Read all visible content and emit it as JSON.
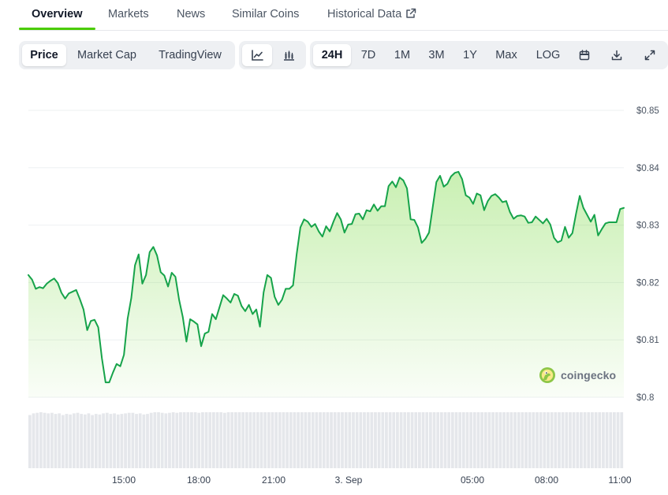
{
  "tabs": [
    {
      "label": "Overview",
      "active": true
    },
    {
      "label": "Markets"
    },
    {
      "label": "News"
    },
    {
      "label": "Similar Coins"
    },
    {
      "label": "Historical Data",
      "icon": "external-link-icon"
    }
  ],
  "toolbar": {
    "view_tabs": [
      "Price",
      "Market Cap",
      "TradingView"
    ],
    "chart_type_icons": [
      "line-chart-icon",
      "candlestick-chart-icon"
    ],
    "ranges": [
      "24H",
      "7D",
      "1M",
      "3M",
      "1Y",
      "Max",
      "LOG"
    ],
    "action_icons": [
      "calendar-icon",
      "download-icon",
      "fullscreen-icon"
    ]
  },
  "brand": {
    "logo_text": "coingecko",
    "logo_icon": "coingecko-gecko-icon"
  },
  "colors": {
    "line": "#16a34a",
    "accent": "#4bcc00",
    "volume": "#e5e7eb"
  },
  "chart_data": {
    "type": "area",
    "xlabel": "",
    "ylabel": "",
    "x_ticks": [
      "15:00",
      "18:00",
      "21:00",
      "3. Sep",
      "05:00",
      "08:00",
      "11:00"
    ],
    "y_ticks": [
      "$0.85",
      "$0.84",
      "$0.83",
      "$0.82",
      "$0.81",
      "$0.8"
    ],
    "ylim": [
      0.8,
      0.85
    ],
    "grid": true,
    "legend": "none",
    "series": [
      {
        "values": [
          0.8213,
          0.8205,
          0.8189,
          0.8192,
          0.819,
          0.8198,
          0.8203,
          0.8207,
          0.8199,
          0.8182,
          0.8172,
          0.8181,
          0.8184,
          0.8187,
          0.8171,
          0.8153,
          0.8117,
          0.8133,
          0.8135,
          0.8122,
          0.8068,
          0.8026,
          0.8026,
          0.8043,
          0.8058,
          0.8054,
          0.8074,
          0.8137,
          0.8173,
          0.823,
          0.8249,
          0.8198,
          0.8213,
          0.8253,
          0.8262,
          0.8247,
          0.8218,
          0.8212,
          0.8193,
          0.8217,
          0.821,
          0.817,
          0.814,
          0.8097,
          0.8136,
          0.8132,
          0.8127,
          0.8089,
          0.8111,
          0.8114,
          0.8145,
          0.8136,
          0.8157,
          0.8178,
          0.8172,
          0.8165,
          0.818,
          0.8177,
          0.8159,
          0.815,
          0.8161,
          0.8145,
          0.8153,
          0.8123,
          0.8183,
          0.8213,
          0.8208,
          0.8175,
          0.8161,
          0.817,
          0.8189,
          0.8189,
          0.8195,
          0.825,
          0.8296,
          0.831,
          0.8306,
          0.8297,
          0.8302,
          0.8289,
          0.828,
          0.8298,
          0.8289,
          0.8306,
          0.8321,
          0.831,
          0.8287,
          0.8301,
          0.8302,
          0.8319,
          0.832,
          0.831,
          0.8326,
          0.8324,
          0.8336,
          0.8325,
          0.8333,
          0.8333,
          0.8368,
          0.8376,
          0.8366,
          0.8383,
          0.8378,
          0.8364,
          0.831,
          0.8309,
          0.8296,
          0.8269,
          0.8276,
          0.8287,
          0.8331,
          0.8375,
          0.8386,
          0.8367,
          0.8372,
          0.8385,
          0.8391,
          0.8393,
          0.838,
          0.8352,
          0.8348,
          0.8337,
          0.8355,
          0.8352,
          0.8326,
          0.8342,
          0.8351,
          0.8354,
          0.8348,
          0.834,
          0.8342,
          0.8323,
          0.8311,
          0.8316,
          0.8317,
          0.8315,
          0.8304,
          0.8305,
          0.8315,
          0.8309,
          0.8303,
          0.8311,
          0.8301,
          0.8278,
          0.827,
          0.8273,
          0.8297,
          0.8278,
          0.8286,
          0.832,
          0.8351,
          0.833,
          0.8318,
          0.8306,
          0.8318,
          0.8282,
          0.8293,
          0.8303,
          0.8305,
          0.8305,
          0.8305,
          0.8328,
          0.833
        ]
      }
    ],
    "volume": {
      "values": [
        0.95,
        0.98,
        0.99,
        1.0,
        0.99,
        0.98,
        0.99,
        0.97,
        0.98,
        0.95,
        0.97,
        0.96,
        0.98,
        0.99,
        0.97,
        0.96,
        0.98,
        0.95,
        0.97,
        0.96,
        0.98,
        0.99,
        0.97,
        0.98,
        0.96,
        0.97,
        0.98,
        0.99,
        0.99,
        0.97,
        0.98,
        0.96,
        0.97,
        0.99,
        1.0,
        1.0,
        0.99,
        0.98,
        0.99,
        1.0,
        0.99,
        1.0,
        1.0,
        1.0,
        1.0,
        1.0,
        0.99,
        1.0,
        1.0,
        1.0,
        1.0,
        1.0,
        1.0,
        0.99,
        1.0,
        1.0,
        1.0,
        1.0,
        1.0,
        1.0,
        1.0,
        1.0,
        1.0,
        1.0,
        1.0,
        1.0,
        1.0,
        1.0,
        1.0,
        1.0,
        1.0,
        1.0,
        1.0,
        1.0,
        1.0,
        1.0,
        1.0,
        1.0,
        1.0,
        1.0,
        1.0,
        1.0,
        1.0,
        1.0,
        1.0,
        1.0,
        1.0,
        1.0,
        1.0,
        1.0,
        1.0,
        1.0,
        1.0,
        1.0,
        1.0,
        1.0,
        1.0,
        1.0,
        1.0,
        1.0,
        1.0,
        1.0,
        1.0,
        1.0,
        1.0,
        1.0,
        1.0,
        1.0,
        1.0,
        1.0,
        1.0,
        1.0,
        1.0,
        1.0,
        1.0,
        1.0,
        1.0,
        1.0,
        1.0,
        1.0,
        1.0,
        1.0,
        1.0,
        1.0,
        1.0,
        1.0,
        1.0,
        1.0,
        1.0,
        1.0,
        1.0,
        1.0,
        1.0,
        1.0,
        1.0,
        1.0,
        1.0,
        1.0,
        1.0,
        1.0,
        1.0,
        1.0,
        1.0,
        1.0,
        1.0,
        1.0,
        1.0,
        1.0,
        1.0,
        1.0,
        1.0,
        1.0,
        1.0,
        1.0,
        1.0,
        1.0,
        1.0,
        1.0,
        1.0,
        1.0,
        1.0,
        1.0
      ]
    }
  }
}
